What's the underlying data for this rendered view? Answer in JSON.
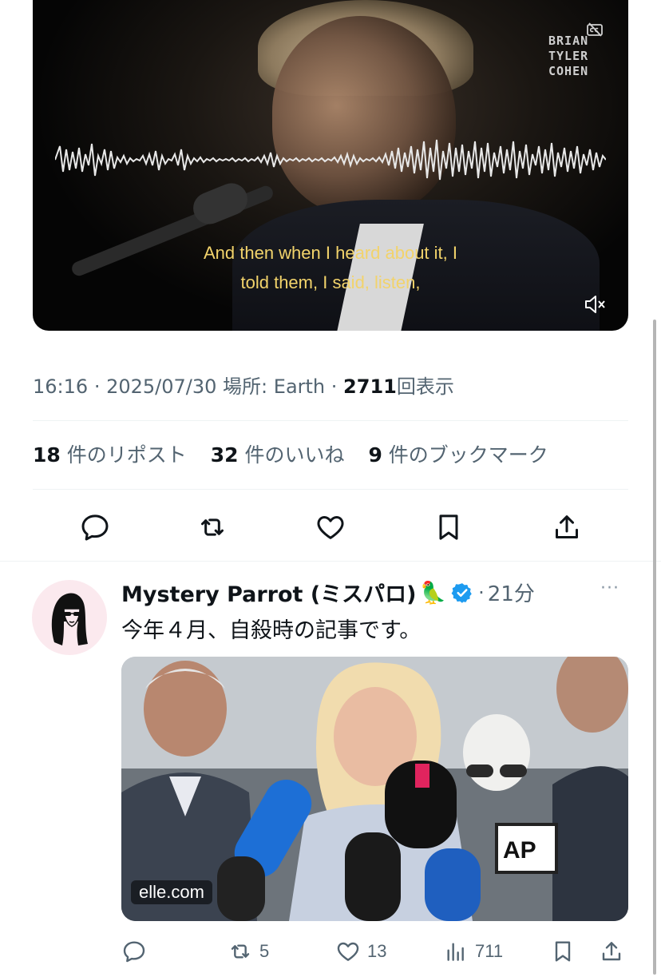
{
  "video": {
    "watermark": [
      "BRIAN",
      "TYLER",
      "COHEN"
    ],
    "caption_lines": [
      "And then when I heard about it, I",
      "told them, I said, listen,"
    ],
    "icons": {
      "captions": "cc-icon",
      "mute": "muted-speaker-icon"
    }
  },
  "meta": {
    "time": "16:16",
    "date": "2025/07/30",
    "location_label": "場所:",
    "location": "Earth",
    "views": "2711",
    "views_label": "回表示"
  },
  "stats": {
    "reposts": {
      "count": "18",
      "label": "件のリポスト"
    },
    "likes": {
      "count": "32",
      "label": "件のいいね"
    },
    "bookmarks": {
      "count": "9",
      "label": "件のブックマーク"
    }
  },
  "actions": [
    "reply-icon",
    "repost-icon",
    "like-icon",
    "bookmark-icon",
    "share-icon"
  ],
  "reply_tweet": {
    "author": "Mystery Parrot (ミスパロ)",
    "author_emoji": "🦜",
    "verified": true,
    "separator": "·",
    "time_ago": "21分",
    "more": "···",
    "text": "今年４月、自殺時の記事です。",
    "card_domain": "elle.com",
    "reposts": "5",
    "likes": "13",
    "views": "711"
  },
  "colors": {
    "accent_blue": "#1d9bf0",
    "secondary_text": "#536471",
    "caption_yellow": "#f2d36b"
  }
}
